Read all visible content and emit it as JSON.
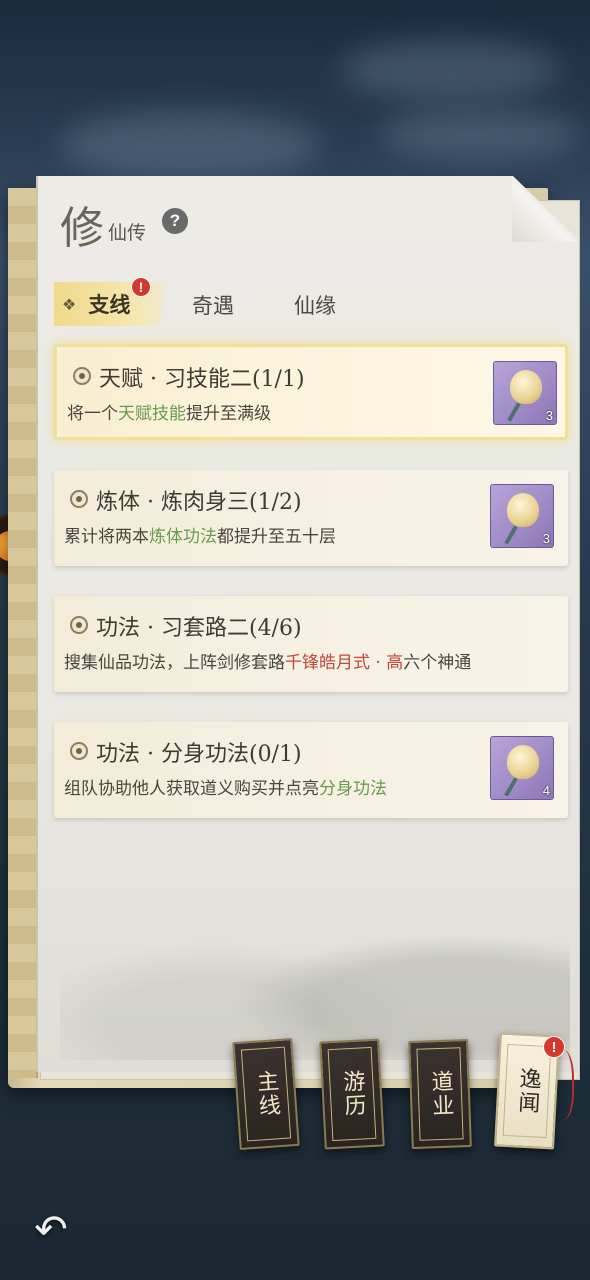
{
  "header": {
    "title_big": "修",
    "title_small": "仙传",
    "help_label": "?"
  },
  "tabs": [
    {
      "label": "支线",
      "active": true,
      "badge": "!"
    },
    {
      "label": "奇遇",
      "active": false
    },
    {
      "label": "仙缘",
      "active": false
    }
  ],
  "quests": [
    {
      "title": "天赋 · 习技能二(1/1)",
      "desc": [
        {
          "t": "将一个",
          "hl": ""
        },
        {
          "t": "天赋技能",
          "hl": "green"
        },
        {
          "t": "提升至满级",
          "hl": ""
        }
      ],
      "reward_icon": "jade-pendant-icon",
      "reward_count": "3",
      "active": true
    },
    {
      "title": "炼体 · 炼肉身三(1/2)",
      "desc": [
        {
          "t": "累计将两本",
          "hl": ""
        },
        {
          "t": "炼体功法",
          "hl": "green"
        },
        {
          "t": "都提升至五十层",
          "hl": ""
        }
      ],
      "reward_icon": "jade-pendant-icon",
      "reward_count": "3",
      "active": false
    },
    {
      "title": "功法 · 习套路二(4/6)",
      "desc": [
        {
          "t": "搜集仙品功法，上阵剑修套路",
          "hl": ""
        },
        {
          "t": "千锋皓月式 · 高",
          "hl": "red"
        },
        {
          "t": "六个神通",
          "hl": ""
        }
      ],
      "reward_icon": "",
      "reward_count": "",
      "active": false
    },
    {
      "title": "功法 · 分身功法(0/1)",
      "desc": [
        {
          "t": "组队协助他人获取道义购买并点亮",
          "hl": ""
        },
        {
          "t": "分身功法",
          "hl": "green"
        }
      ],
      "reward_icon": "jade-pendant-icon",
      "reward_count": "4",
      "active": false
    }
  ],
  "chapters": [
    {
      "label": "主线",
      "active": false
    },
    {
      "label": "游历",
      "active": false
    },
    {
      "label": "道业",
      "active": false
    },
    {
      "label": "逸闻",
      "active": true,
      "badge": "!"
    }
  ],
  "nav": {
    "back_icon": "back-arrow-icon"
  },
  "colors": {
    "highlight_green": "#6a9a4f",
    "highlight_red": "#c2483a",
    "badge_red": "#d6382e"
  }
}
